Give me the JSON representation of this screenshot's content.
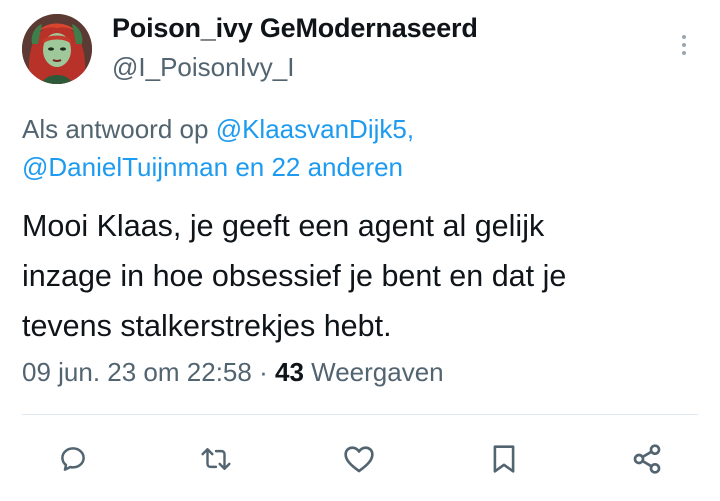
{
  "author": {
    "display_name": "Poison_ivy GeModernaseerd",
    "handle": "@I_PoisonIvy_I",
    "avatar_icon": "avatar-comic-redhead"
  },
  "reply_context": {
    "prefix": "Als antwoord op",
    "mention_1": "@KlaasvanDijk5,",
    "mention_2": "@DanielTuijnman",
    "suffix": "en 22 anderen"
  },
  "tweet": {
    "lines": [
      "Mooi Klaas, je geeft een agent al gelijk",
      "inzage in hoe obsessief je bent en dat je",
      "tevens stalkerstrekjes hebt."
    ]
  },
  "meta": {
    "timestamp": "09 jun. 23 om 22:58",
    "separator": "·",
    "views_count": "43",
    "views_label": "Weergaven"
  },
  "actions": {
    "reply_icon": "reply-icon",
    "retweet_icon": "retweet-icon",
    "like_icon": "like-icon",
    "bookmark_icon": "bookmark-icon",
    "share_icon": "share-icon"
  },
  "colors": {
    "mention": "#1d9bf0",
    "secondary_text": "#536471",
    "primary_text": "#0f1419",
    "icon": "#536471"
  }
}
